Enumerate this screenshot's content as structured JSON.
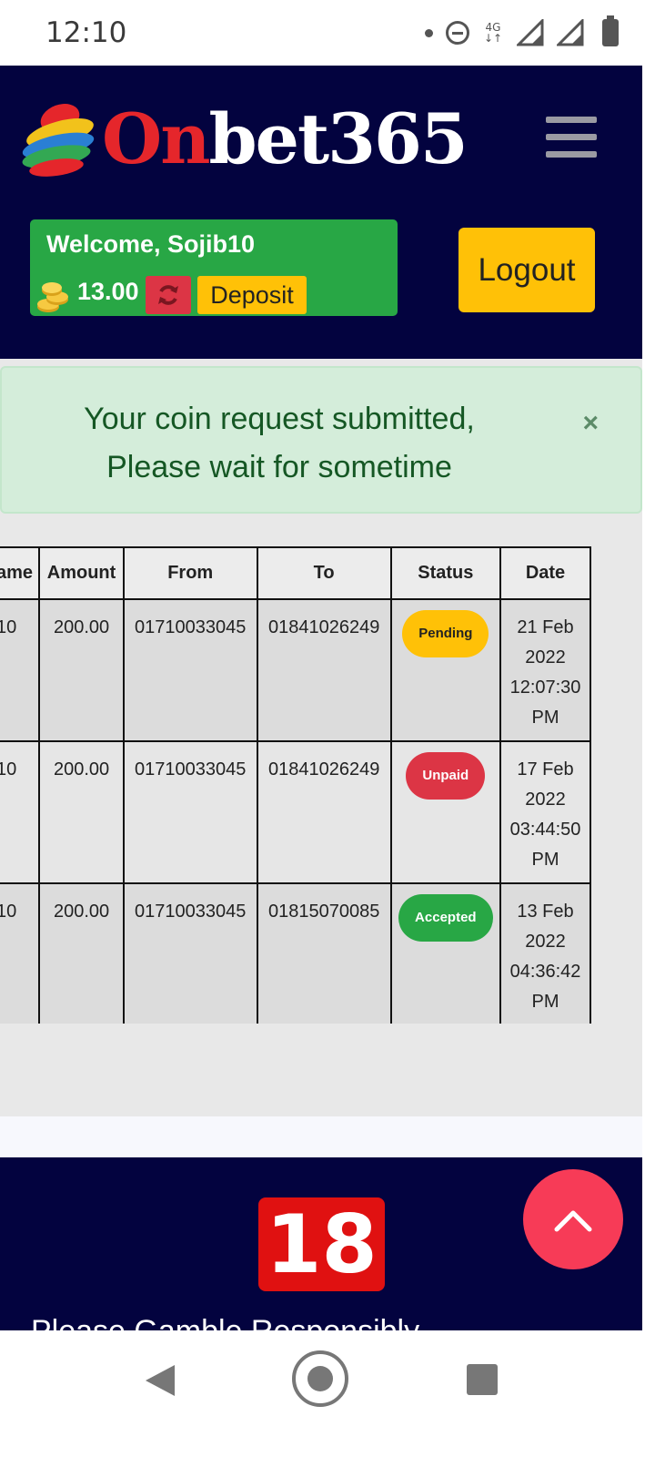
{
  "status_bar": {
    "time": "12:10",
    "network": "4G",
    "icons": [
      "notification-dot-icon",
      "do-not-disturb-icon",
      "4g-data-icon",
      "signal-icon",
      "signal-icon",
      "battery-icon"
    ]
  },
  "header": {
    "logo": {
      "part1": "On",
      "part2": "bet365"
    },
    "menu_icon": "hamburger-menu-icon",
    "welcome": "Welcome, Sojib10",
    "balance": "13.00",
    "refresh_icon": "refresh-icon",
    "deposit_label": "Deposit",
    "logout_label": "Logout"
  },
  "alert": {
    "line1": "Your coin request submitted,",
    "line2": "Please wait for sometime",
    "close": "×"
  },
  "table": {
    "headers": [
      "ame",
      "Amount",
      "From",
      "To",
      "Status",
      "Date"
    ],
    "rows": [
      {
        "name": "10",
        "amount": "200.00",
        "from": "01710033045",
        "to": "01841026249",
        "status": "Pending",
        "date": [
          "21 Feb",
          "2022",
          "12:07:30",
          "PM"
        ]
      },
      {
        "name": "10",
        "amount": "200.00",
        "from": "01710033045",
        "to": "01841026249",
        "status": "Unpaid",
        "date": [
          "17 Feb",
          "2022",
          "03:44:50",
          "PM"
        ]
      },
      {
        "name": "10",
        "amount": "200.00",
        "from": "01710033045",
        "to": "01815070085",
        "status": "Accepted",
        "date": [
          "13 Feb",
          "2022",
          "04:36:42",
          "PM"
        ]
      }
    ]
  },
  "footer": {
    "age_badge": "18",
    "gamble_text": "Please Gamble Responsibly"
  },
  "colors": {
    "navy": "#03033f",
    "green": "#28a745",
    "yellow": "#ffc107",
    "red": "#dc3545",
    "alert_bg": "#d4edda",
    "scroll_top": "#f73b57"
  }
}
